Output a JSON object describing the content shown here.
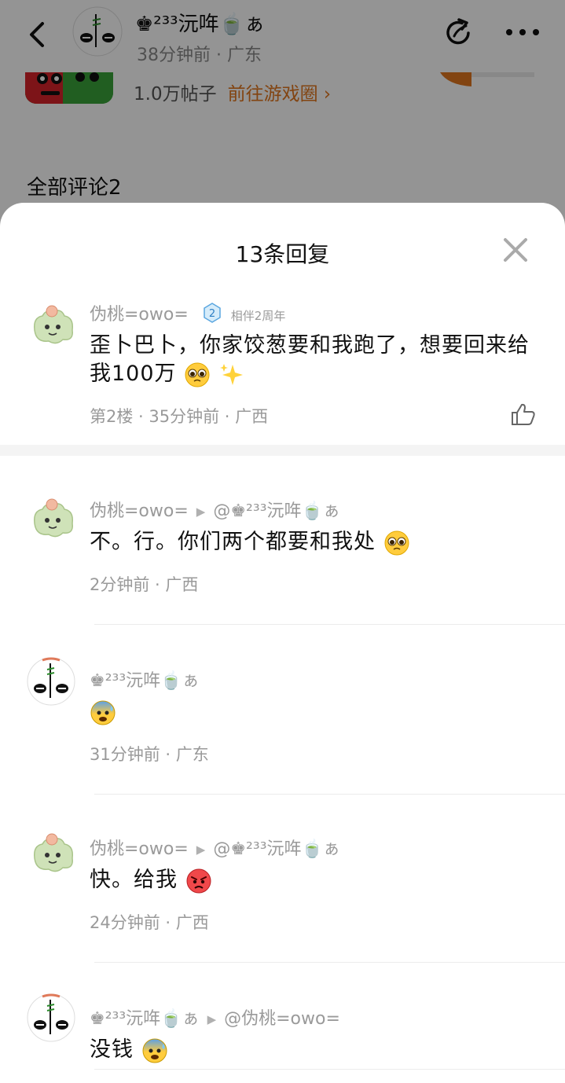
{
  "header": {
    "author_name": "♚²³³沅哖🍵ぁ",
    "author_meta": "38分钟前 · 广东",
    "game_posts": "1.0万帖子",
    "game_link": "前往游戏圈 ›",
    "all_comments": "全部评论2"
  },
  "sheet": {
    "title": "13条回复"
  },
  "main_comment": {
    "user": "伪桃=owo=",
    "badge_level": "2",
    "badge_text": "相伴2周年",
    "text": "歪卜巴卜，你家饺葱要和我跑了，想要回来给我100万",
    "meta": "第2楼 · 35分钟前 · 广西"
  },
  "replies": [
    {
      "user": "伪桃=owo=",
      "reply_to": "@♚²³³沅哖🍵ぁ",
      "text": "不。行。你们两个都要和我处",
      "meta": "2分钟前 · 广西"
    },
    {
      "user": "♚²³³沅哖🍵ぁ",
      "reply_to": "",
      "text": "",
      "meta": "31分钟前 · 广东"
    },
    {
      "user": "伪桃=owo=",
      "reply_to": "@♚²³³沅哖🍵ぁ",
      "text": "快。给我",
      "meta": "24分钟前 · 广西"
    },
    {
      "user": "♚²³³沅哖🍵ぁ",
      "reply_to": "@伪桃=owo=",
      "text": "没钱",
      "meta": ""
    }
  ],
  "colors": {
    "accent_orange": "#e0761e",
    "meta_gray": "#9a9a9a"
  }
}
